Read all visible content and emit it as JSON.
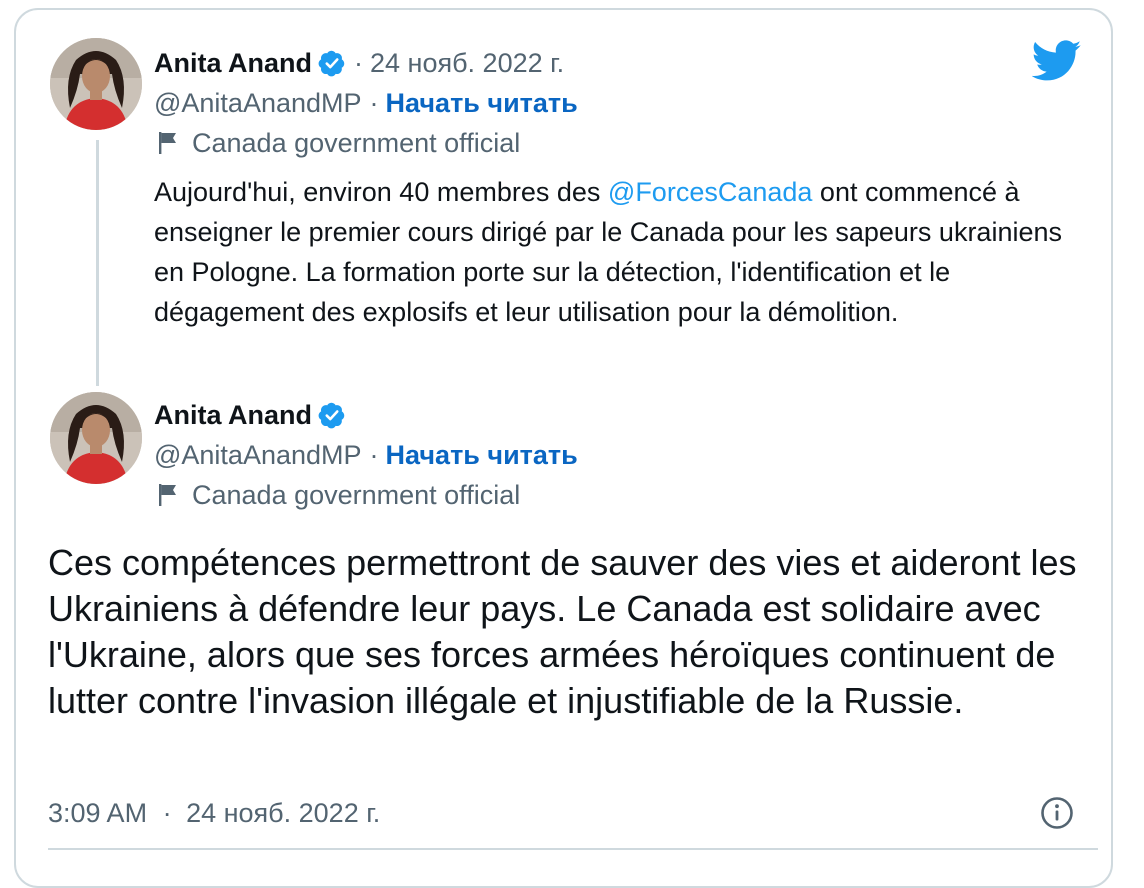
{
  "quoted_tweet": {
    "author_name": "Anita Anand",
    "separator": "·",
    "date": "24 нояб. 2022 г.",
    "handle": "@AnitaAnandMP",
    "follow_label": "Начать читать",
    "account_label": "Canada government official",
    "text_before_mention": "Aujourd'hui, environ 40 membres des ",
    "mention": "@ForcesCanada",
    "text_after_mention": " ont commencé à enseigner le premier cours dirigé par le Canada pour les sapeurs ukrainiens en Pologne. La formation porte sur la détection, l'identification et le dégagement des explosifs et leur utilisation pour la démolition."
  },
  "main_tweet": {
    "author_name": "Anita Anand",
    "handle": "@AnitaAnandMP",
    "separator": "·",
    "follow_label": "Начать читать",
    "account_label": "Canada government official",
    "text": "Ces compétences permettront de sauver des vies et aideront les Ukrainiens à défendre leur pays. Le Canada est solidaire avec l'Ukraine, alors que ses forces armées héroïques continuent de lutter contre l'invasion illégale et injustifiable de la Russie.",
    "time": "3:09 AM",
    "date": "24 нояб. 2022 г."
  },
  "icons": {
    "verified": "verified-badge-icon",
    "flag": "flag-icon",
    "bird": "twitter-bird-icon",
    "info": "info-icon"
  },
  "colors": {
    "accent_blue": "#1d9bf0",
    "follow_blue": "#0a66c2",
    "muted": "#536471",
    "border": "#cfd9de"
  }
}
